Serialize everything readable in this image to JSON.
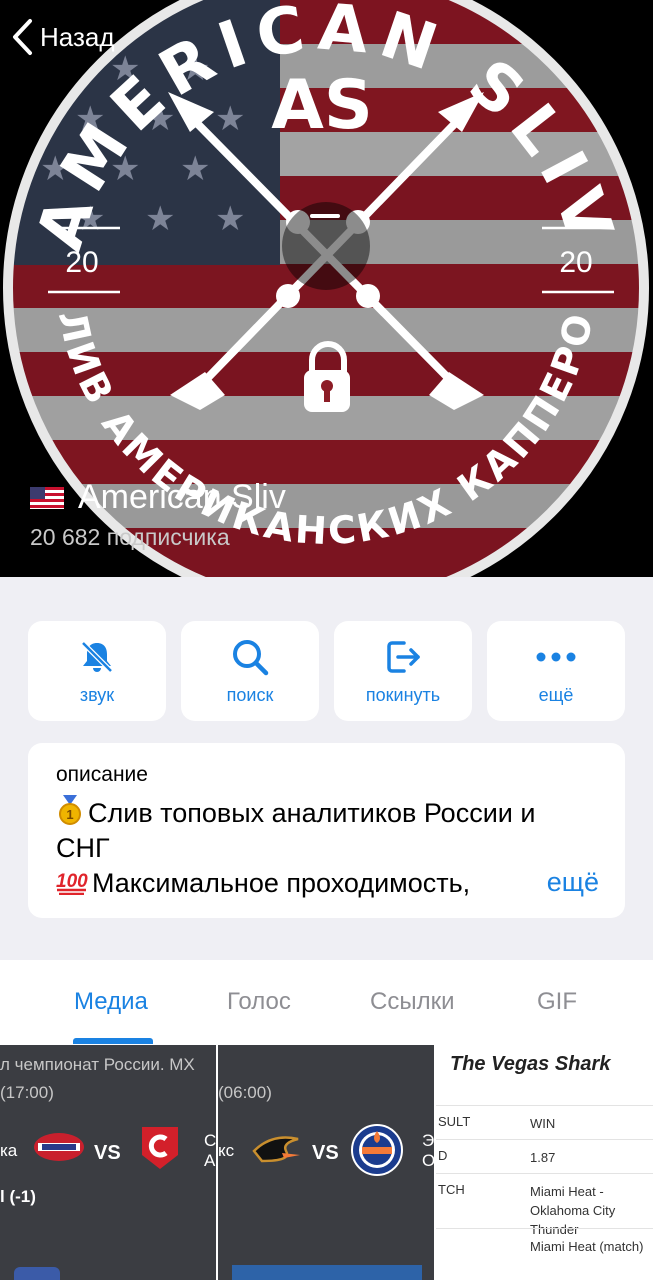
{
  "header": {
    "back_label": "Назад",
    "channel_name": "American Sliv",
    "subscribers": "20 682 подписчика",
    "logo_text": {
      "top": "AMERICAN SLIV",
      "center": "AS",
      "year_left": "20",
      "year_right": "20",
      "bottom": "СЛИВ АМЕРИКАНСКИХ КАППЕРОВ"
    }
  },
  "actions": [
    {
      "label": "звук",
      "icon": "bell-muted-icon"
    },
    {
      "label": "поиск",
      "icon": "search-icon"
    },
    {
      "label": "покинуть",
      "icon": "leave-icon"
    },
    {
      "label": "ещё",
      "icon": "more-dots-icon"
    }
  ],
  "description": {
    "title": "описание",
    "line1": "Слив топовых аналитиков России и",
    "line2": "СНГ",
    "line3": "Максимальное проходимость, ",
    "more": "ещё"
  },
  "tabs": [
    "Медиа",
    "Голос",
    "Ссылки",
    "GIF"
  ],
  "active_tab": "Медиа",
  "media": {
    "tile1": {
      "title": "л чемпионат России. МХ",
      "time": "(17:00)",
      "left_team": "ка",
      "vs": "VS",
      "right_team_abbr": "С",
      "right_team_abbr2": "А",
      "handicap": "l (-1)"
    },
    "tile2": {
      "time": "(06:00)",
      "left_team": "кс",
      "vs": "VS",
      "right_abbr": "Э",
      "right_abbr2": "О"
    },
    "tile3": {
      "title": "The Vegas Shark",
      "rows": [
        {
          "k": "SULT",
          "v": "WIN"
        },
        {
          "k": "D",
          "v": "1.87"
        },
        {
          "k": "TCH",
          "v": "Miami Heat - Oklahoma City Thunder"
        },
        {
          "k": "",
          "v": "Miami Heat (match)"
        }
      ]
    }
  },
  "colors": {
    "accent": "#1a82e2",
    "background": "#efeff4"
  }
}
